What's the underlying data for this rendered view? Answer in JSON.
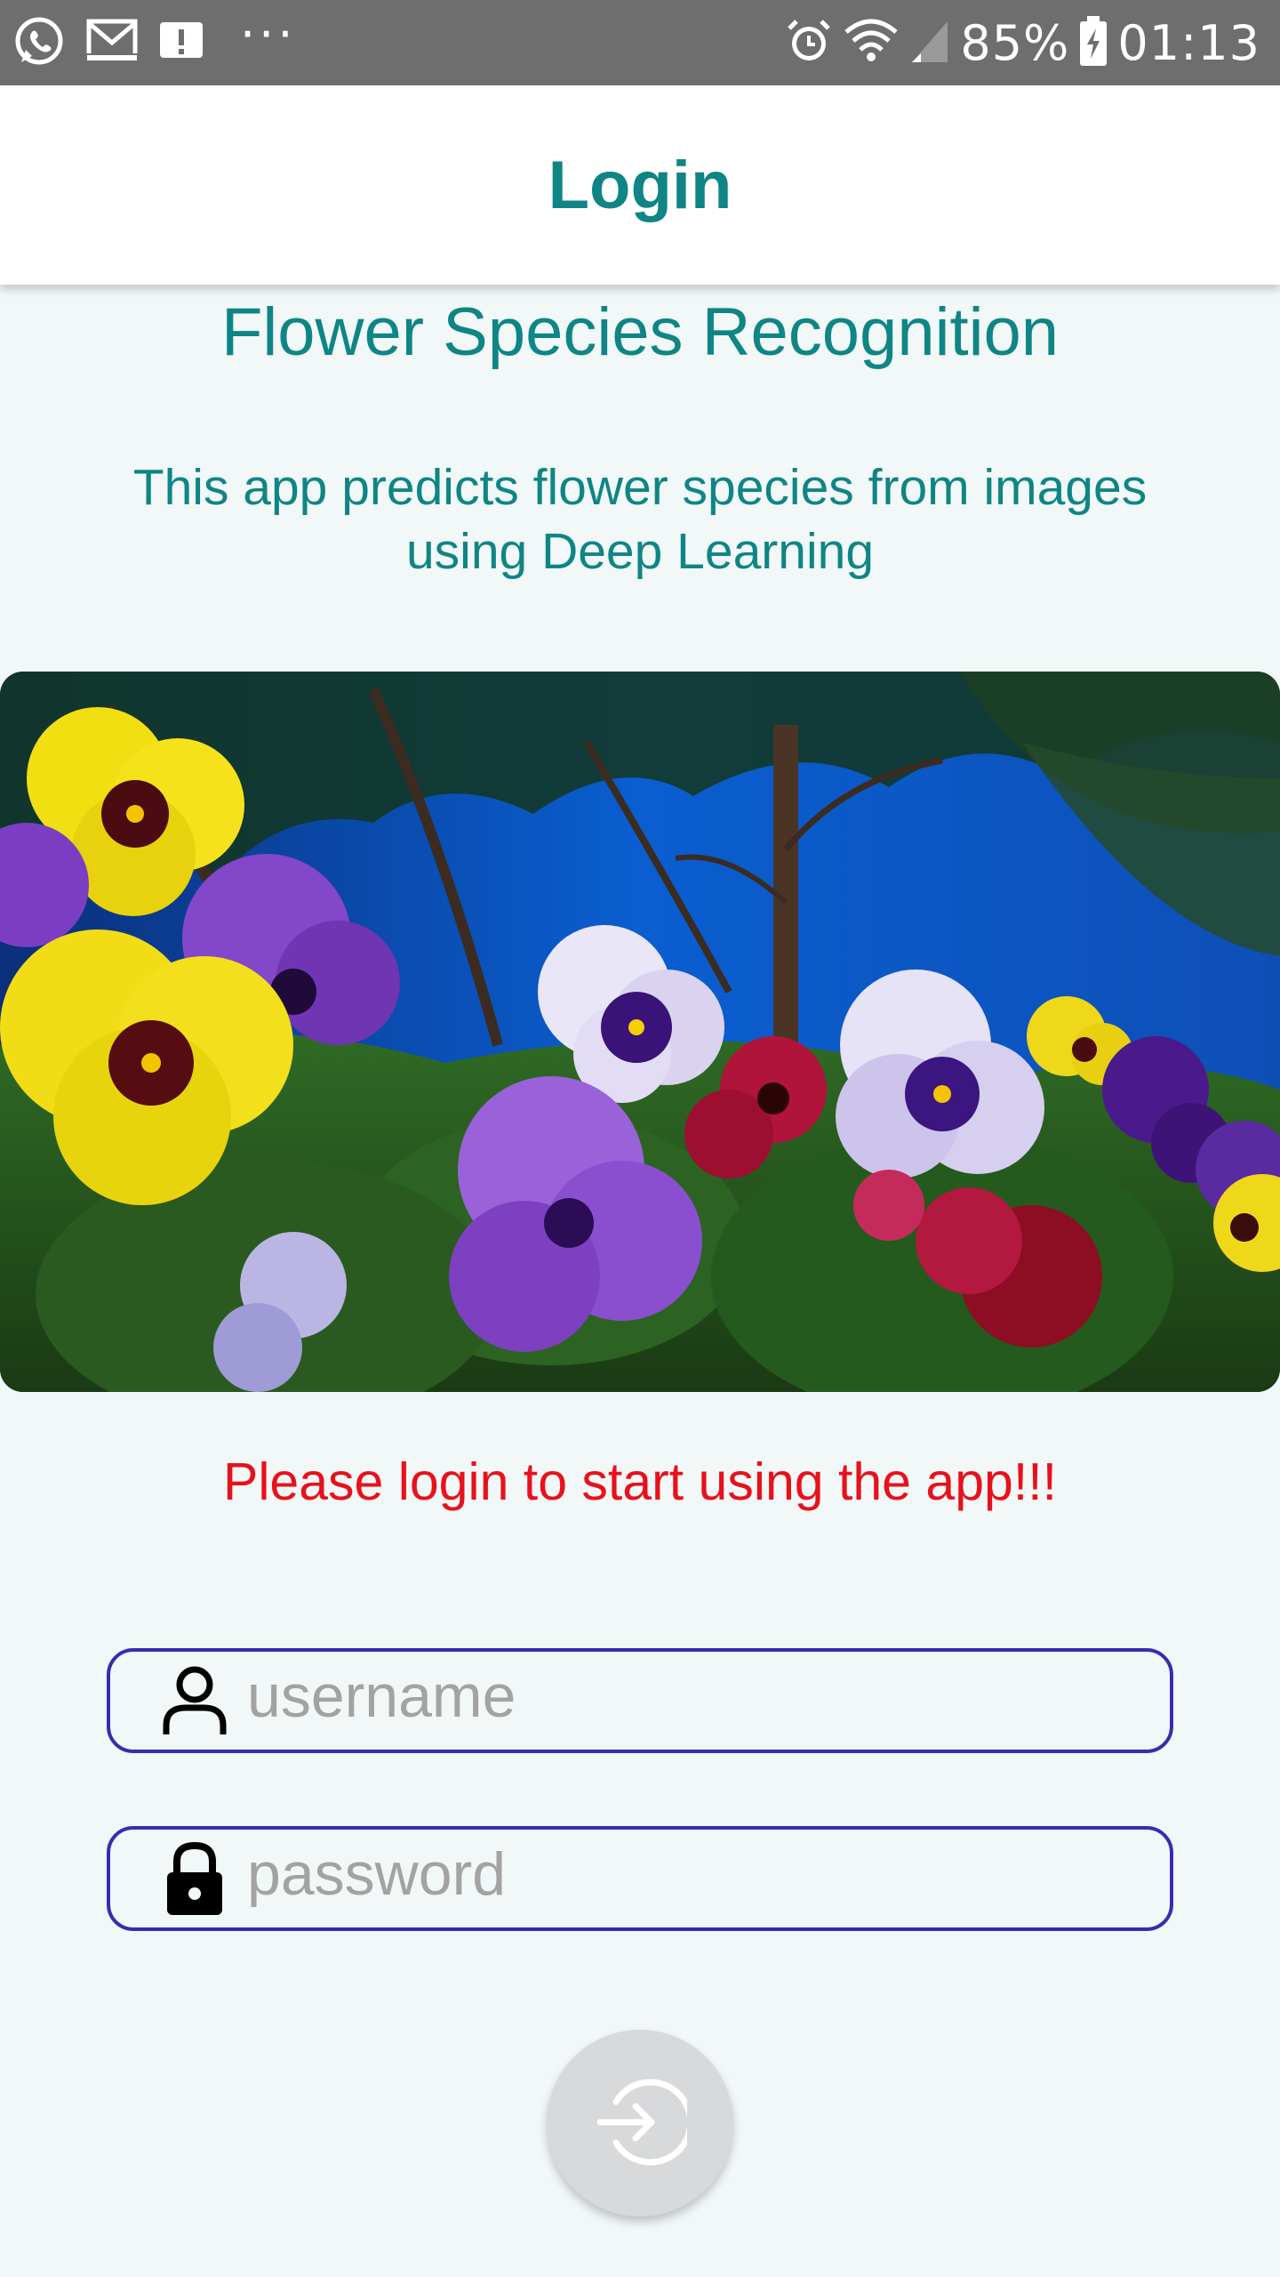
{
  "status_bar": {
    "battery": "85%",
    "time": "01:13",
    "more": "···",
    "icons": [
      "whatsapp-icon",
      "gmail-icon",
      "alert-icon",
      "alarm-icon",
      "wifi-icon",
      "signal-icon",
      "battery-charging-icon"
    ]
  },
  "app_bar": {
    "title": "Login"
  },
  "main": {
    "title": "Flower Species Recognition",
    "description": "This app predicts flower species from images using Deep Learning",
    "hero_image": "pansy-flowers-image",
    "login_prompt": "Please login to start using the app!!!"
  },
  "form": {
    "username": {
      "placeholder": "username",
      "value": "",
      "icon": "person-icon"
    },
    "password": {
      "placeholder": "password",
      "value": "",
      "icon": "lock-icon"
    },
    "submit_icon": "login-arrow-icon"
  },
  "colors": {
    "accent": "#0f8585",
    "error": "#e8111b",
    "field_border": "#3b2bb0",
    "background": "#f2f8f8",
    "status_bar": "#6e6e6e"
  }
}
